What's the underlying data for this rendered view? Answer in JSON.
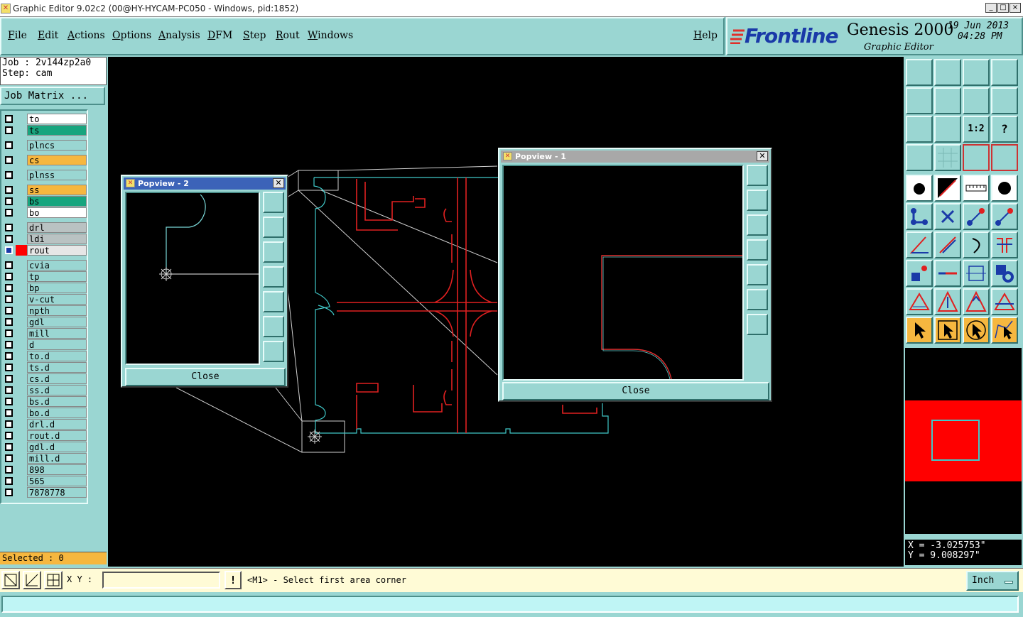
{
  "window": {
    "title": "Graphic Editor 9.02c2 (00@HY-HYCAM-PC050 - Windows, pid:1852)",
    "controls": [
      "_",
      "□",
      "×"
    ]
  },
  "menu": {
    "items": [
      "File",
      "Edit",
      "Actions",
      "Options",
      "Analysis",
      "DFM",
      "Step",
      "Rout",
      "Windows"
    ],
    "help": "Help"
  },
  "brand": {
    "logo": "Frontline",
    "product": "Genesis 2000",
    "subtitle": "Graphic Editor",
    "date": "19  Jun 2013",
    "time": "04:28 PM"
  },
  "job": {
    "job_line": "Job : 2v144zp2a0",
    "step_line": "Step: cam",
    "matrix_button": "Job Matrix ..."
  },
  "layers": [
    {
      "name": "to",
      "color": "#ffffff"
    },
    {
      "name": "ts",
      "color": "#17a57e"
    },
    {
      "name": "plncs",
      "color": "#9ad6d2"
    },
    {
      "name": "cs",
      "color": "#f6b73f"
    },
    {
      "name": "plnss",
      "color": "#9ad6d2"
    },
    {
      "name": "ss",
      "color": "#f6b73f"
    },
    {
      "name": "bs",
      "color": "#17a57e"
    },
    {
      "name": "bo",
      "color": "#ffffff"
    },
    {
      "name": "drl",
      "color": "#b9c2c2"
    },
    {
      "name": "ldi",
      "color": "#b9c2c2"
    },
    {
      "name": "rout",
      "color": "#e6e6e6",
      "active": true
    },
    {
      "name": "cvia",
      "color": "#9ad6d2"
    },
    {
      "name": "tp",
      "color": "#9ad6d2"
    },
    {
      "name": "bp",
      "color": "#9ad6d2"
    },
    {
      "name": "v-cut",
      "color": "#9ad6d2"
    },
    {
      "name": "npth",
      "color": "#9ad6d2"
    },
    {
      "name": "gdl",
      "color": "#9ad6d2"
    },
    {
      "name": "mill",
      "color": "#9ad6d2"
    },
    {
      "name": "d",
      "color": "#9ad6d2"
    },
    {
      "name": "to.d",
      "color": "#9ad6d2"
    },
    {
      "name": "ts.d",
      "color": "#9ad6d2"
    },
    {
      "name": "cs.d",
      "color": "#9ad6d2"
    },
    {
      "name": "ss.d",
      "color": "#9ad6d2"
    },
    {
      "name": "bs.d",
      "color": "#9ad6d2"
    },
    {
      "name": "bo.d",
      "color": "#9ad6d2"
    },
    {
      "name": "drl.d",
      "color": "#9ad6d2"
    },
    {
      "name": "rout.d",
      "color": "#9ad6d2"
    },
    {
      "name": "gdl.d",
      "color": "#9ad6d2"
    },
    {
      "name": "mill.d",
      "color": "#9ad6d2"
    },
    {
      "name": "898",
      "color": "#9ad6d2"
    },
    {
      "name": "565",
      "color": "#9ad6d2"
    },
    {
      "name": "7878778",
      "color": "#9ad6d2"
    }
  ],
  "selected": "Selected : 0",
  "popview2": {
    "title": "Popview - 2",
    "close": "Close"
  },
  "popview1": {
    "title": "Popview - 1",
    "close": "Close"
  },
  "coords": {
    "x": "X = -3.025753\"",
    "y": "Y = 9.008297\""
  },
  "bottom": {
    "xy_label": "X Y :",
    "xy_value": "",
    "prompt_icon": "!",
    "prompt": "<M1> - Select first area corner",
    "units": "Inch"
  },
  "colors": {
    "panel": "#9ad6d2",
    "canvas": "#000000",
    "outline": "#40c8c8",
    "rout": "#e02020",
    "selected_bar": "#f6b73f",
    "overview": "#ff0000"
  }
}
